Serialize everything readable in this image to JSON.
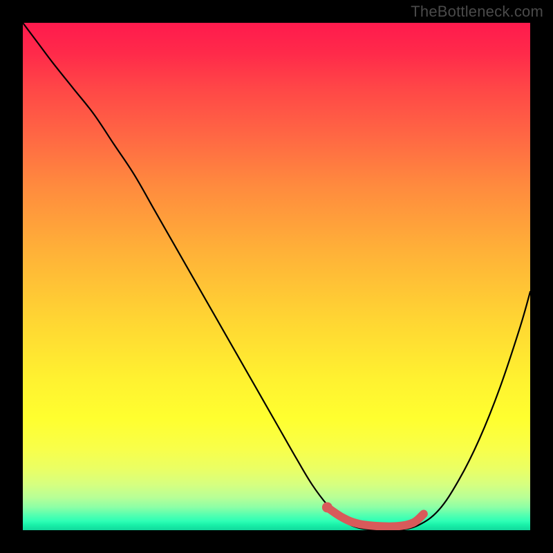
{
  "watermark": "TheBottleneck.com",
  "chart_data": {
    "type": "line",
    "title": "",
    "xlabel": "",
    "ylabel": "",
    "xlim": [
      0,
      100
    ],
    "ylim": [
      0,
      100
    ],
    "series": [
      {
        "name": "curve",
        "x": [
          0,
          3,
          6,
          10,
          14,
          18,
          22,
          26,
          30,
          34,
          38,
          42,
          46,
          50,
          54,
          57,
          60,
          63,
          66,
          70,
          74,
          78,
          82,
          86,
          90,
          94,
          98,
          100
        ],
        "y": [
          100,
          96,
          92,
          87,
          82,
          76,
          70,
          63,
          56,
          49,
          42,
          35,
          28,
          21,
          14,
          9,
          5,
          2,
          0.5,
          0,
          0,
          1,
          4,
          10,
          18,
          28,
          40,
          47
        ]
      },
      {
        "name": "highlight",
        "x": [
          60,
          63,
          66,
          70,
          74,
          77,
          79
        ],
        "y": [
          4.5,
          2.5,
          1.3,
          0.8,
          0.8,
          1.5,
          3.2
        ]
      }
    ],
    "highlight_marker": {
      "x": 60,
      "y": 4.5
    }
  }
}
